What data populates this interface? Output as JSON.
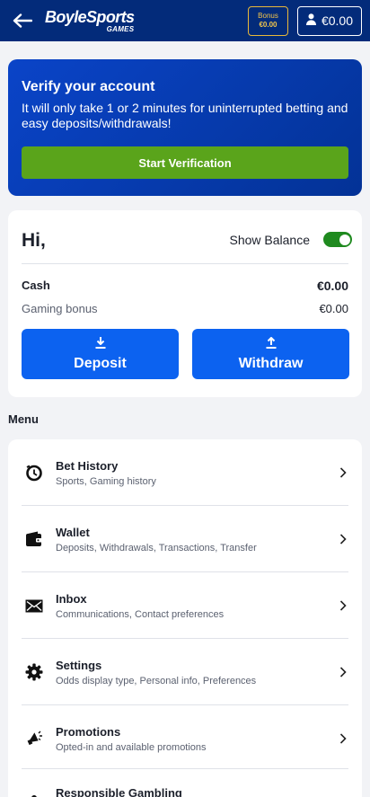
{
  "header": {
    "logo_main": "BoyleSports",
    "logo_sub": "GAMES",
    "bonus_label": "Bonus",
    "bonus_value": "€0.00",
    "balance": "€0.00"
  },
  "verify": {
    "title": "Verify your account",
    "text": "It will only take 1 or 2 minutes for uninterrupted betting and easy deposits/withdrawals!",
    "button": "Start Verification"
  },
  "account": {
    "greeting": "Hi,",
    "show_balance_label": "Show Balance",
    "show_balance_on": true,
    "cash_label": "Cash",
    "cash_value": "€0.00",
    "gaming_bonus_label": "Gaming bonus",
    "gaming_bonus_value": "€0.00",
    "deposit_label": "Deposit",
    "withdraw_label": "Withdraw"
  },
  "menu": {
    "title": "Menu",
    "items": [
      {
        "title": "Bet History",
        "subtitle": "Sports, Gaming history",
        "icon": "clock-history-icon"
      },
      {
        "title": "Wallet",
        "subtitle": "Deposits, Withdrawals, Transactions, Transfer",
        "icon": "wallet-icon"
      },
      {
        "title": "Inbox",
        "subtitle": "Communications, Contact preferences",
        "icon": "envelope-icon"
      },
      {
        "title": "Settings",
        "subtitle": "Odds display type, Personal info, Preferences",
        "icon": "gear-icon"
      },
      {
        "title": "Promotions",
        "subtitle": "Opted-in and available promotions",
        "icon": "megaphone-icon"
      },
      {
        "title": "Responsible Gambling",
        "subtitle": "",
        "icon": "person-icon"
      }
    ]
  },
  "colors": {
    "header_bg": "#032b7a",
    "verify_button": "#5aa41b",
    "action_button": "#0c62f0",
    "toggle_on": "#1f8a1f",
    "bonus_gold": "#f3c54a"
  }
}
